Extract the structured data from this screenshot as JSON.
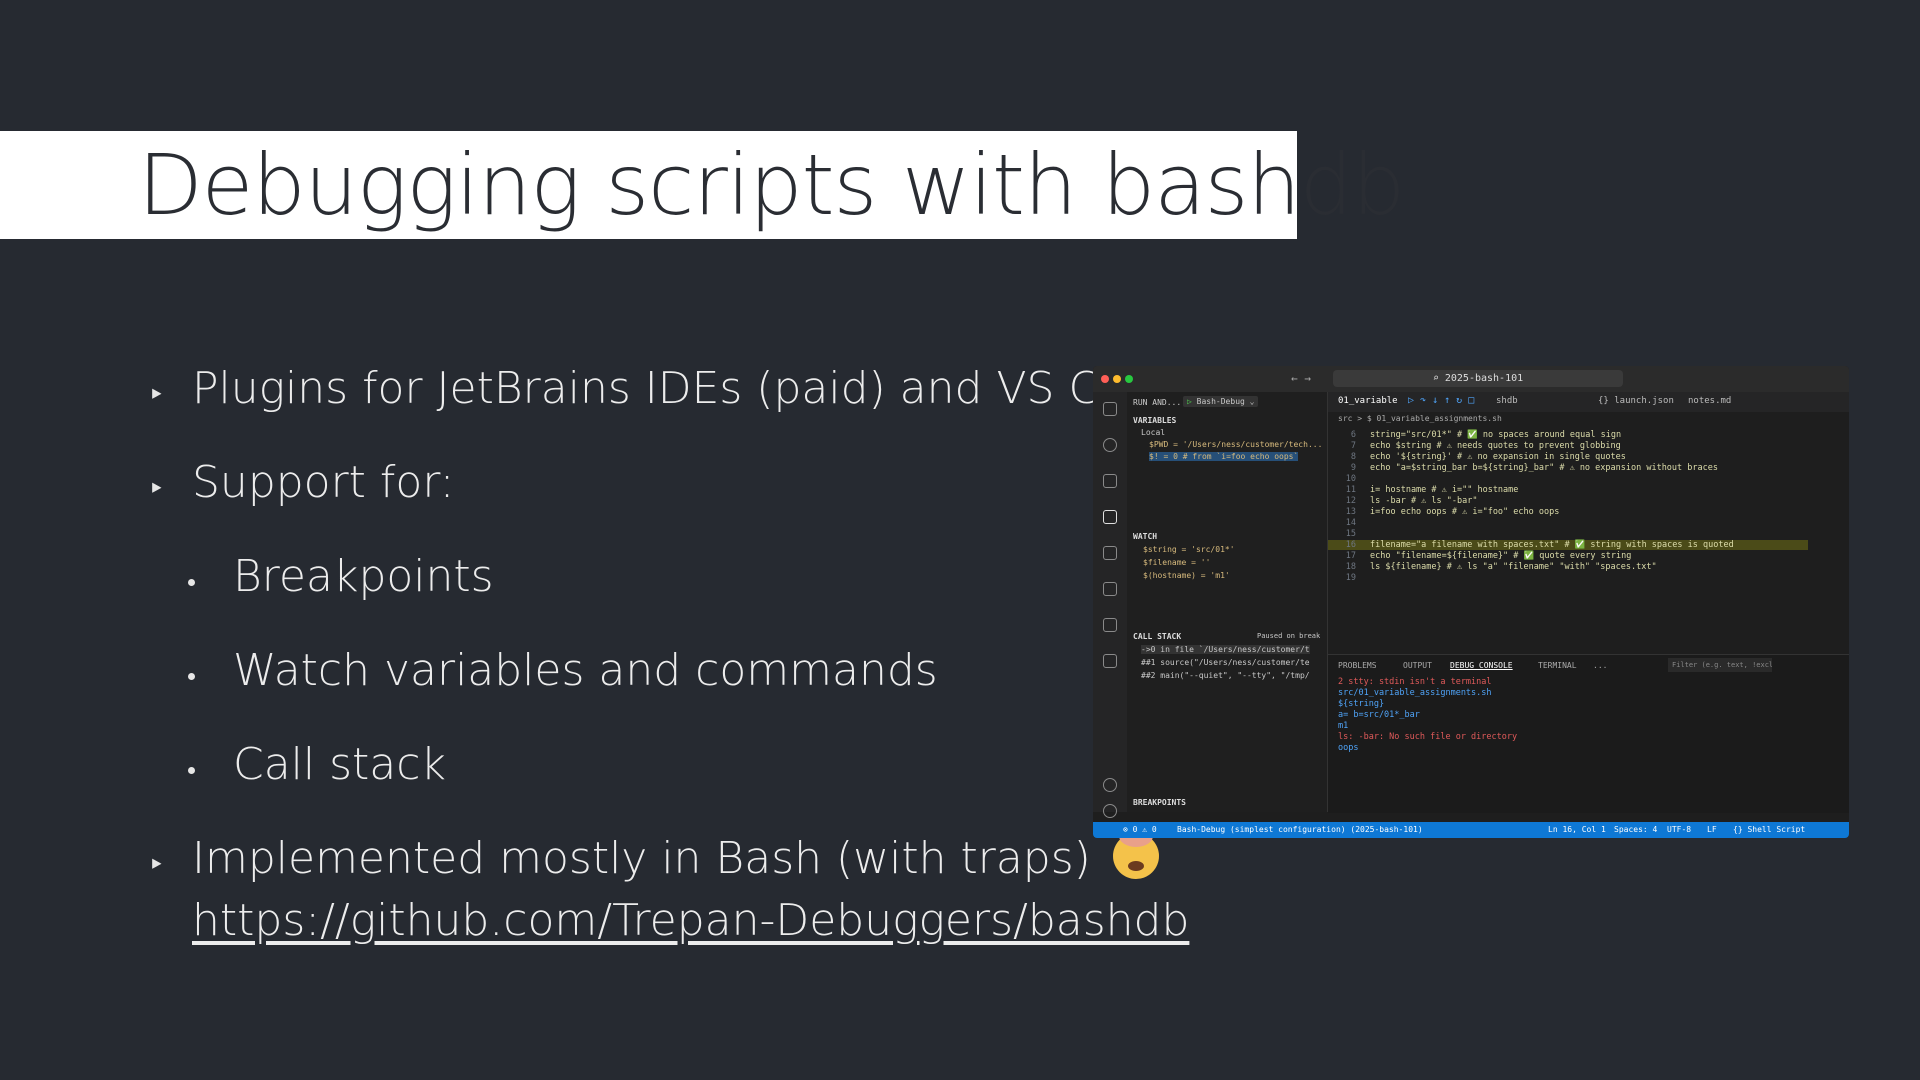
{
  "slide": {
    "title": "Debugging scripts with bashdb",
    "bullets": [
      "Plugins for JetBrains IDEs (paid) and VS Code",
      "Support for:",
      "Breakpoints",
      "Watch variables and commands",
      "Call stack",
      "Implemented mostly in Bash (with traps)",
      "https://github.com/Trepan-Debuggers/bashdb"
    ],
    "emoji": "exploding-head-emoji"
  },
  "vscode": {
    "search": "2025-bash-101",
    "sidebar": {
      "header": "RUN AND...",
      "config": "Bash-Debug",
      "variables_title": "VARIABLES",
      "local": "Local",
      "vars": [
        "$PWD = '/Users/ness/customer/tech...",
        "$! = 0 # from `i=foo echo oops`"
      ],
      "watch_title": "WATCH",
      "watch": [
        "$string = 'src/01*'",
        "$filename = ''",
        "$(hostname) = 'm1'"
      ],
      "callstack_title": "CALL STACK",
      "callstack_status": "Paused on break",
      "frames": [
        "->0 in file `/Users/ness/customer/t",
        "##1 source(\"/Users/ness/customer/te",
        "##2 main(\"--quiet\", \"--tty\", \"/tmp/"
      ],
      "breakpoints_title": "BREAKPOINTS"
    },
    "tabs": [
      "01_variable",
      "shdb",
      "{} launch.json",
      "notes.md"
    ],
    "breadcrumb": "src > $ 01_variable_assignments.sh",
    "code": [
      {
        "n": "6",
        "t": "string=\"src/01*\" # ✅ no spaces around equal sign"
      },
      {
        "n": "7",
        "t": "echo $string # ⚠ needs quotes to prevent globbing"
      },
      {
        "n": "8",
        "t": "echo '${string}' # ⚠ no expansion in single quotes"
      },
      {
        "n": "9",
        "t": "echo \"a=$string_bar b=${string}_bar\"  # ⚠ no expansion without braces"
      },
      {
        "n": "10",
        "t": ""
      },
      {
        "n": "11",
        "t": "i= hostname # ⚠ i=\"\" hostname"
      },
      {
        "n": "12",
        "t": "ls -bar # ⚠ ls \"-bar\""
      },
      {
        "n": "13",
        "t": "i=foo echo oops # ⚠ i=\"foo\" echo oops"
      },
      {
        "n": "14",
        "t": ""
      },
      {
        "n": "15",
        "t": ""
      },
      {
        "n": "16",
        "t": "filename=\"a filename with spaces.txt\" # ✅ string with spaces is quoted"
      },
      {
        "n": "17",
        "t": "echo \"filename=${filename}\" # ✅ quote every string"
      },
      {
        "n": "18",
        "t": "ls ${filename} # ⚠ ls \"a\" \"filename\" \"with\" \"spaces.txt\""
      },
      {
        "n": "19",
        "t": ""
      }
    ],
    "panel_tabs": [
      "PROBLEMS",
      "OUTPUT",
      "DEBUG CONSOLE",
      "TERMINAL",
      "..."
    ],
    "filter_placeholder": "Filter (e.g. text, !exclu...",
    "console": [
      {
        "t": "2 stty: stdin isn't a terminal",
        "c": "#e05a5a"
      },
      {
        "t": "src/01_variable_assignments.sh",
        "c": "#4fa3f7"
      },
      {
        "t": "${string}",
        "c": "#4fa3f7"
      },
      {
        "t": "a= b=src/01*_bar",
        "c": "#4fa3f7"
      },
      {
        "t": "m1",
        "c": "#4fa3f7"
      },
      {
        "t": "ls: -bar: No such file or directory",
        "c": "#e05a5a"
      },
      {
        "t": "oops",
        "c": "#4fa3f7"
      }
    ],
    "status": {
      "problems": "⊗ 0 ⚠ 0",
      "debug": "Bash-Debug (simplest configuration) (2025-bash-101)",
      "position": "Ln 16, Col 1",
      "spaces": "Spaces: 4",
      "encoding": "UTF-8",
      "eol": "LF",
      "lang": "{} Shell Script"
    }
  }
}
